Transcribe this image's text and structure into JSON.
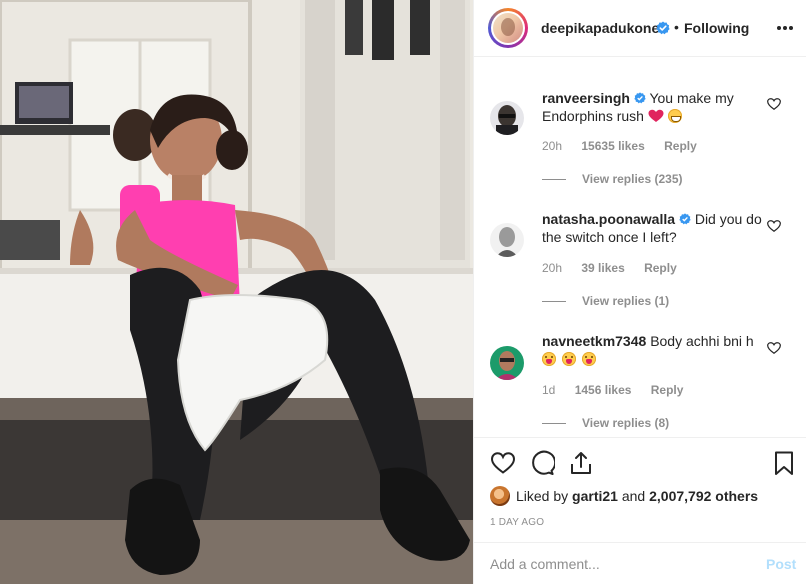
{
  "post": {
    "photo_icon": "gym-photo"
  },
  "header": {
    "username": "deepikapadukone",
    "separator": "•",
    "follow_status": "Following",
    "more_icon": "more-horizontal-icon",
    "verified_icon": "verified-badge-icon"
  },
  "comments": [
    {
      "username": "ranveersingh",
      "verified": true,
      "text": "You make my Endorphins rush",
      "emojis": [
        "red-heart",
        "grinning-squint"
      ],
      "time": "20h",
      "likes": "15635 likes",
      "reply": "Reply",
      "view_replies": "View replies (235)"
    },
    {
      "username": "natasha.poonawalla",
      "verified": true,
      "text": "Did you do the switch once I left?",
      "emojis": [],
      "time": "20h",
      "likes": "39 likes",
      "reply": "Reply",
      "view_replies": "View replies (1)"
    },
    {
      "username": "navneetkm7348",
      "verified": false,
      "text": "Body achhi bni h",
      "emojis": [
        "tongue-wink",
        "tongue-wink",
        "tongue-wink"
      ],
      "time": "1d",
      "likes": "1456 likes",
      "reply": "Reply",
      "view_replies": "View replies (8)"
    }
  ],
  "actions": {
    "like_icon": "heart-outline-icon",
    "comment_icon": "comment-bubble-icon",
    "share_icon": "share-icon",
    "save_icon": "bookmark-icon",
    "liked_by_prefix": "Liked by",
    "liked_by_user": "garti21",
    "liked_by_and": "and",
    "liked_by_others": "2,007,792 others",
    "time_ago": "1 DAY AGO"
  },
  "add_comment": {
    "placeholder": "Add a comment...",
    "post_label": "Post"
  },
  "colors": {
    "text": "#262626",
    "secondary": "#8e8e8e",
    "verified": "#3897f0",
    "post_disabled": "#b2dffc",
    "border": "#efefef"
  }
}
